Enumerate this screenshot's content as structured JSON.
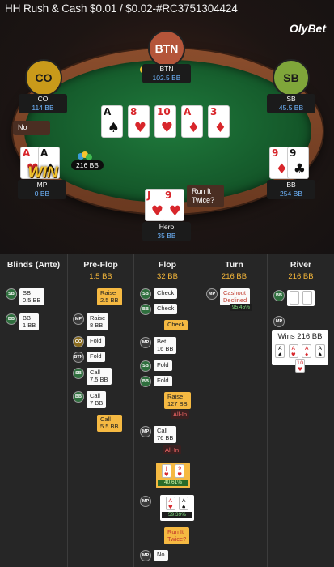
{
  "title": "HH  Rush & Cash $0.01 / $0.02-#RC3751304424",
  "brand": "OlyBet",
  "colors": {
    "accent": "#f4b63a",
    "felt": "#1a6b34",
    "rail": "#7a4326",
    "stack_blue": "#6fb6ff"
  },
  "table": {
    "seats": [
      {
        "id": "BTN",
        "avatar": "BTN",
        "name": "BTN",
        "stack": "102.5 BB",
        "dealer_chip": "D"
      },
      {
        "id": "CO",
        "avatar": "CO",
        "name": "CO",
        "stack": "114 BB"
      },
      {
        "id": "SB",
        "avatar": "SB",
        "name": "SB",
        "stack": "45.5 BB"
      },
      {
        "id": "MP",
        "avatar": "WIN",
        "name": "MP",
        "stack": "0 BB",
        "action": "No",
        "hole_cards": [
          {
            "rank": "A",
            "suit": "♥"
          },
          {
            "rank": "A",
            "suit": "♠"
          }
        ]
      },
      {
        "id": "BB",
        "avatar": "",
        "name": "BB",
        "stack": "254 BB",
        "hole_cards": [
          {
            "rank": "9",
            "suit": "♦"
          },
          {
            "rank": "9",
            "suit": "♣"
          }
        ]
      },
      {
        "id": "Hero",
        "avatar": "",
        "name": "Hero",
        "stack": "35 BB",
        "action": "Run It Twice?",
        "hole_cards": [
          {
            "rank": "J",
            "suit": "♥"
          },
          {
            "rank": "9",
            "suit": "♥"
          }
        ]
      }
    ],
    "board": [
      {
        "rank": "A",
        "suit": "♠"
      },
      {
        "rank": "8",
        "suit": "♥"
      },
      {
        "rank": "10",
        "suit": "♥"
      },
      {
        "rank": "A",
        "suit": "♦"
      },
      {
        "rank": "3",
        "suit": "♦"
      }
    ],
    "pot": "216 BB"
  },
  "history": {
    "columns": [
      {
        "header": "Blinds (Ante)",
        "pot": ""
      },
      {
        "header": "Pre-Flop",
        "pot": "1.5 BB"
      },
      {
        "header": "Flop",
        "pot": "32 BB"
      },
      {
        "header": "Turn",
        "pot": "216 BB"
      },
      {
        "header": "River",
        "pot": "216 BB"
      }
    ],
    "blinds": [
      {
        "player": "SB",
        "text": "SB\n0.5 BB"
      },
      {
        "player": "BB",
        "text": "BB\n1 BB"
      }
    ],
    "preflop": [
      {
        "player": "",
        "text": "Raise\n2.5 BB"
      },
      {
        "player": "MP",
        "text": "Raise\n8 BB"
      },
      {
        "player": "CO",
        "text": "Fold"
      },
      {
        "player": "BTN",
        "text": "Fold"
      },
      {
        "player": "SB",
        "text": "Call\n7.5 BB"
      },
      {
        "player": "BB",
        "text": "Call\n7 BB"
      },
      {
        "player": "",
        "text": "Call\n5.5 BB"
      }
    ],
    "flop": [
      {
        "player": "SB",
        "text": "Check"
      },
      {
        "player": "BB",
        "text": "Check"
      },
      {
        "player": "",
        "text": "Check"
      },
      {
        "player": "MP",
        "text": "Bet\n16 BB"
      },
      {
        "player": "SB",
        "text": "Fold"
      },
      {
        "player": "BB",
        "text": "Fold"
      },
      {
        "player": "",
        "text": "Raise\n127 BB",
        "tag": "All-In"
      },
      {
        "player": "MP",
        "text": "Call\n76 BB",
        "tag": "All-In"
      },
      {
        "player": "",
        "equity": "40.61%",
        "cards": [
          {
            "rank": "J",
            "suit": "♥"
          },
          {
            "rank": "9",
            "suit": "♥"
          }
        ]
      },
      {
        "player": "MP",
        "equity": "59.39%",
        "cards": [
          {
            "rank": "A",
            "suit": "♥"
          },
          {
            "rank": "A",
            "suit": "♠"
          }
        ]
      },
      {
        "player": "",
        "text": "Run It\nTwice?"
      },
      {
        "player": "MP",
        "text": "No"
      }
    ],
    "turn": [
      {
        "player": "MP",
        "text": "Cashout\nDeclined",
        "pct": "95.45%"
      }
    ],
    "river": {
      "player_bb": "BB",
      "player_mp": "MP",
      "win_text": "Wins 216 BB",
      "win_cards": [
        {
          "rank": "A",
          "suit": "♠"
        },
        {
          "rank": "A",
          "suit": "♥"
        },
        {
          "rank": "A",
          "suit": "♦"
        },
        {
          "rank": "A",
          "suit": "♠"
        },
        {
          "rank": "10",
          "suit": "♥"
        }
      ]
    }
  }
}
